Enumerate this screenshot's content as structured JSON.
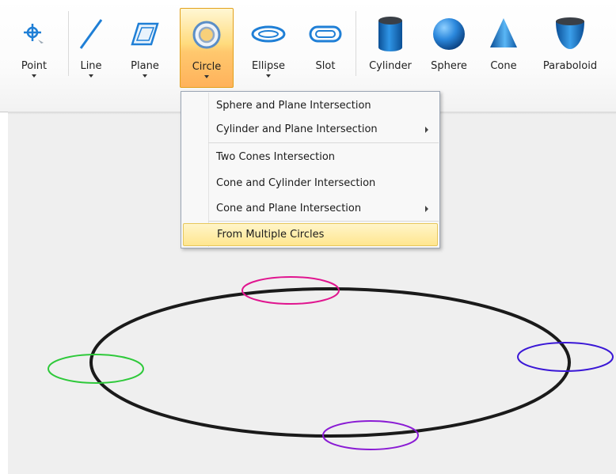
{
  "toolbar": {
    "tools": [
      {
        "label": "Point",
        "icon": "point-icon"
      },
      {
        "label": "Line",
        "icon": "line-icon"
      },
      {
        "label": "Plane",
        "icon": "plane-icon"
      },
      {
        "label": "Circle",
        "icon": "circle-icon",
        "active": true
      },
      {
        "label": "Ellipse",
        "icon": "ellipse-icon"
      },
      {
        "label": "Slot",
        "icon": "slot-icon"
      },
      {
        "label": "Cylinder",
        "icon": "cylinder-icon"
      },
      {
        "label": "Sphere",
        "icon": "sphere-icon"
      },
      {
        "label": "Cone",
        "icon": "cone-icon"
      },
      {
        "label": "Paraboloid",
        "icon": "paraboloid-icon"
      }
    ]
  },
  "circle_menu": {
    "items": [
      {
        "label": "Sphere and Plane Intersection",
        "submenu": false
      },
      {
        "label": "Cylinder and Plane Intersection",
        "submenu": true
      },
      {
        "label": "Two Cones Intersection",
        "submenu": false
      },
      {
        "label": "Cone and Cylinder Intersection",
        "submenu": false
      },
      {
        "label": "Cone and Plane Intersection",
        "submenu": true
      },
      {
        "label": "From Multiple Circles",
        "submenu": false,
        "highlighted": true
      }
    ]
  },
  "scene": {
    "main_circle_color": "#1a1a1a",
    "circle_colors": {
      "top": "#e0158f",
      "left": "#2ec93a",
      "right": "#3a17d6",
      "bottom": "#8a1bd4"
    }
  },
  "colors": {
    "accent_blue": "#1f7fd6",
    "active_tool": "#ffc86e",
    "menu_highlight": "#ffe68f"
  }
}
